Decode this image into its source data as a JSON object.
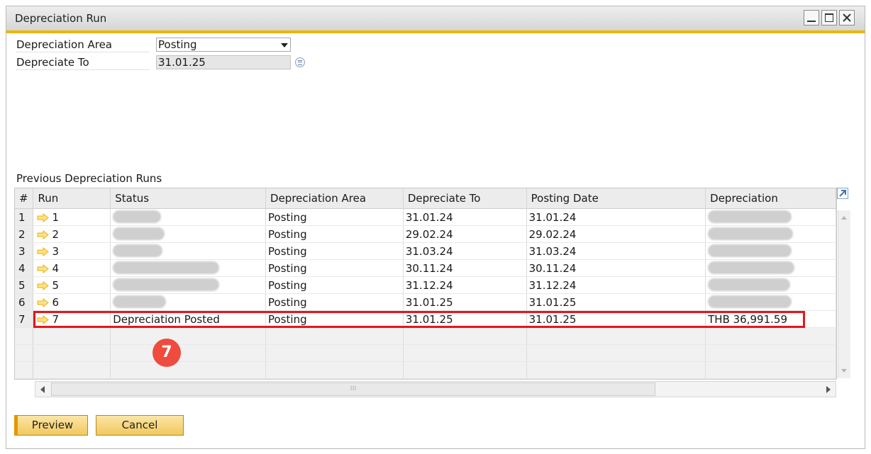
{
  "window": {
    "title": "Depreciation Run"
  },
  "form": {
    "depreciation_area_label": "Depreciation Area",
    "depreciation_area_value": "Posting",
    "depreciate_to_label": "Depreciate To",
    "depreciate_to_value": "31.01.25"
  },
  "previous_runs": {
    "title": "Previous Depreciation Runs",
    "columns": [
      "#",
      "Run",
      "Status",
      "Depreciation Area",
      "Depreciate To",
      "Posting Date",
      "Depreciation"
    ],
    "rows": [
      {
        "num": "1",
        "run": "1",
        "status": "",
        "area": "Posting",
        "depreciate_to": "31.01.24",
        "posting_date": "31.01.24",
        "depreciation": ""
      },
      {
        "num": "2",
        "run": "2",
        "status": "",
        "area": "Posting",
        "depreciate_to": "29.02.24",
        "posting_date": "29.02.24",
        "depreciation": ""
      },
      {
        "num": "3",
        "run": "3",
        "status": "",
        "area": "Posting",
        "depreciate_to": "31.03.24",
        "posting_date": "31.03.24",
        "depreciation": ""
      },
      {
        "num": "4",
        "run": "4",
        "status": "",
        "area": "Posting",
        "depreciate_to": "30.11.24",
        "posting_date": "30.11.24",
        "depreciation": ""
      },
      {
        "num": "5",
        "run": "5",
        "status": "",
        "area": "Posting",
        "depreciate_to": "31.12.24",
        "posting_date": "31.12.24",
        "depreciation": ""
      },
      {
        "num": "6",
        "run": "6",
        "status": "",
        "area": "Posting",
        "depreciate_to": "31.01.25",
        "posting_date": "31.01.25",
        "depreciation": ""
      },
      {
        "num": "7",
        "run": "7",
        "status": "Depreciation Posted",
        "area": "Posting",
        "depreciate_to": "31.01.25",
        "posting_date": "31.01.25",
        "depreciation": "THB 36,991.59"
      }
    ]
  },
  "annotation": {
    "step_number": "7",
    "color": "#e8141b"
  },
  "buttons": {
    "preview": "Preview",
    "cancel": "Cancel"
  },
  "colors": {
    "accent": "#f0b400",
    "arrow": "#f5b800"
  }
}
